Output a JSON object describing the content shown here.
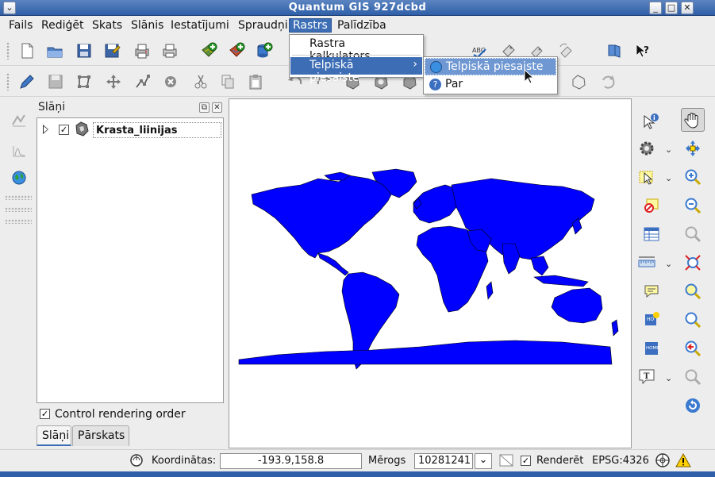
{
  "window": {
    "title": "Quantum GIS 927dcbd"
  },
  "menubar": {
    "items": [
      "Fails",
      "Rediģēt",
      "Skats",
      "Slānis",
      "Iestatījumi",
      "Spraudņi",
      "Rastrs",
      "Palīdzība"
    ],
    "active": "Rastrs"
  },
  "raster_menu": {
    "items": [
      "Rastra kalkulators...",
      "Telpiskā piesaiste"
    ],
    "highlighted": "Telpiskā piesaiste",
    "submenu": {
      "items": [
        "Telpiskā piesaiste",
        "Par"
      ],
      "highlighted": "Telpiskā piesaiste"
    }
  },
  "layers_panel": {
    "title": "Slāņi",
    "layers": [
      {
        "name": "Krasta_liinijas",
        "checked": true
      }
    ],
    "control_rendering_order": "Control rendering order",
    "tabs": [
      "Slāņi",
      "Pārskats"
    ],
    "active_tab": "Slāņi"
  },
  "map": {
    "fill_color": "#0000ff",
    "stroke_color": "#000000",
    "background": "#ffffff"
  },
  "statusbar": {
    "coordinates_label": "Koordinātas:",
    "coordinates_value": "-193.9,158.8",
    "scale_label": "Mērogs",
    "scale_value": "10281241",
    "render_label": "Renderēt",
    "render_checked": true,
    "crs": "EPSG:4326"
  },
  "colors": {
    "titlebar": "#2f5fa8",
    "menu_highlight": "#3d6eb5",
    "submenu_highlight": "#6f97d2"
  }
}
